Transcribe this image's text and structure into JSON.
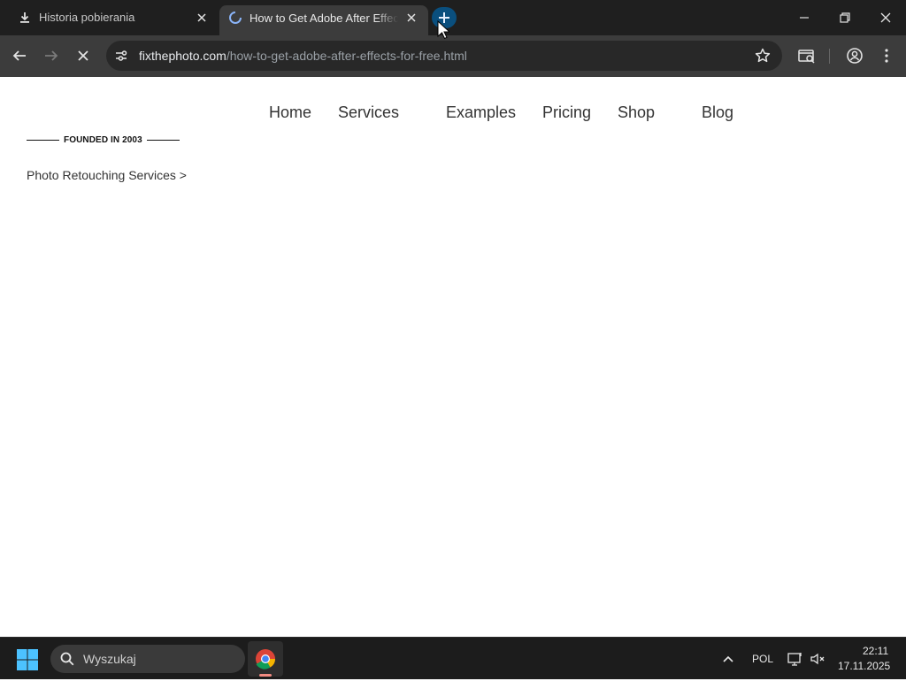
{
  "browser": {
    "tabs": [
      {
        "title": "Historia pobierania",
        "icon": "download-icon",
        "active": false
      },
      {
        "title": "How to Get Adobe After Effects for Free",
        "icon": "loading-spinner-icon",
        "active": true
      }
    ],
    "address": {
      "domain": "fixthephoto.com",
      "path": "/how-to-get-adobe-after-effects-for-free.html"
    }
  },
  "page": {
    "nav": [
      "Home",
      "Services",
      "Examples",
      "Pricing",
      "Shop",
      "Blog"
    ],
    "founded": "FOUNDED IN 2003",
    "breadcrumb": "Photo Retouching Services >"
  },
  "taskbar": {
    "search_placeholder": "Wyszukaj",
    "language": "POL",
    "time": "22:11",
    "date": "17.11.2025"
  },
  "colors": {
    "tabstrip": "#1f1f1f",
    "toolbar": "#3c3c3c",
    "taskbar": "#1c1c1c",
    "new_tab_accent": "#0a4f7e"
  }
}
